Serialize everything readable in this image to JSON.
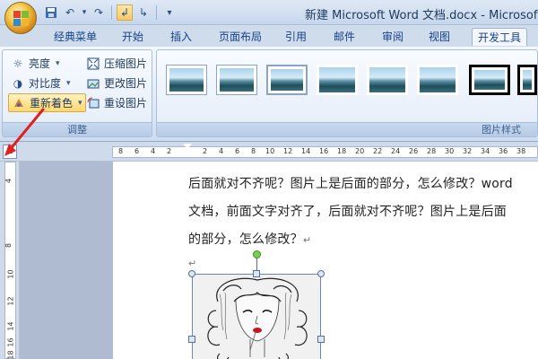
{
  "window": {
    "title": "新建 Microsoft Word 文档.docx - Microsoft W"
  },
  "quick_access": [
    {
      "name": "save-icon",
      "glyph": "💾"
    },
    {
      "name": "undo-icon",
      "glyph": "↶"
    },
    {
      "name": "undo-dropdown-icon",
      "glyph": "▾"
    },
    {
      "name": "redo-icon",
      "glyph": "↷"
    },
    {
      "name": "format-painter-icon",
      "glyph": "⌫"
    },
    {
      "name": "paragraph-ltr-icon",
      "glyph": "¶"
    },
    {
      "name": "paragraph-rtl-icon",
      "glyph": "¶"
    },
    {
      "name": "customize-qat-icon",
      "glyph": "▾"
    }
  ],
  "tabs": [
    "经典菜单",
    "开始",
    "插入",
    "页面布局",
    "引用",
    "邮件",
    "审阅",
    "视图",
    "开发工具"
  ],
  "ribbon": {
    "adjust_group": {
      "label": "调整",
      "brightness": "亮度",
      "contrast": "对比度",
      "recolor": "重新着色",
      "compress": "压缩图片",
      "change": "更改图片",
      "reset": "重设图片"
    },
    "styles_group": {
      "label": "图片样式"
    }
  },
  "ruler": {
    "corner": "L",
    "numbers": [
      "8",
      "6",
      "4",
      "2",
      "2",
      "4",
      "6",
      "8",
      "10",
      "12",
      "14",
      "16",
      "18",
      "20",
      "22",
      "24",
      "26",
      "28",
      "30",
      "32",
      "34",
      "36",
      "38"
    ],
    "left_numbers": [
      "4",
      "8",
      "10",
      "12",
      "14",
      "16",
      "18"
    ]
  },
  "document": {
    "line1": "后面就对不齐呢？图片上是后面的部分，怎么修改？word",
    "line2": "文档，前面文字对齐了，后面就对不齐呢？图片上是后面",
    "line3": "的部分，怎么修改？",
    "para_mark": "↵",
    "return_mark": "↵"
  },
  "colors": {
    "accent": "#15428b",
    "highlight": "#ffd76a",
    "arrow": "#e02020"
  }
}
